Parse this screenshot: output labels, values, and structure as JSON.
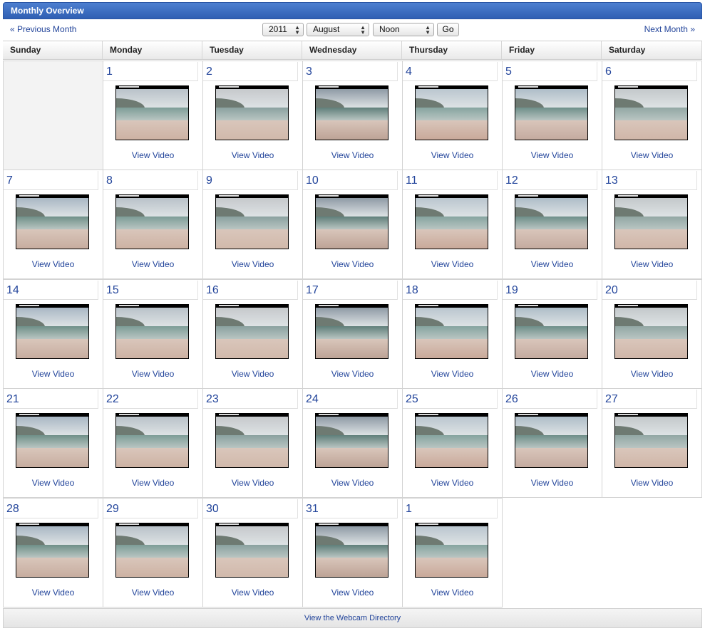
{
  "title": "Monthly Overview",
  "nav": {
    "prev": "« Previous Month",
    "next": "Next Month »",
    "year": "2011",
    "month": "August",
    "time": "Noon",
    "go": "Go"
  },
  "weekdays": [
    "Sunday",
    "Monday",
    "Tuesday",
    "Wednesday",
    "Thursday",
    "Friday",
    "Saturday"
  ],
  "video_label": "View Video",
  "weeks": [
    [
      "",
      "1",
      "2",
      "3",
      "4",
      "5",
      "6"
    ],
    [
      "7",
      "8",
      "9",
      "10",
      "11",
      "12",
      "13"
    ],
    [
      "14",
      "15",
      "16",
      "17",
      "18",
      "19",
      "20"
    ],
    [
      "21",
      "22",
      "23",
      "24",
      "25",
      "26",
      "27"
    ],
    [
      "28",
      "29",
      "30",
      "31",
      "1",
      "",
      ""
    ]
  ],
  "footer": "View the Webcam Directory",
  "colors": {
    "title_bar": "#3b6cc2",
    "link": "#23459b",
    "sky": "#9fb0bd",
    "sea": "#7e9a96",
    "sand": "#c9aea0"
  }
}
